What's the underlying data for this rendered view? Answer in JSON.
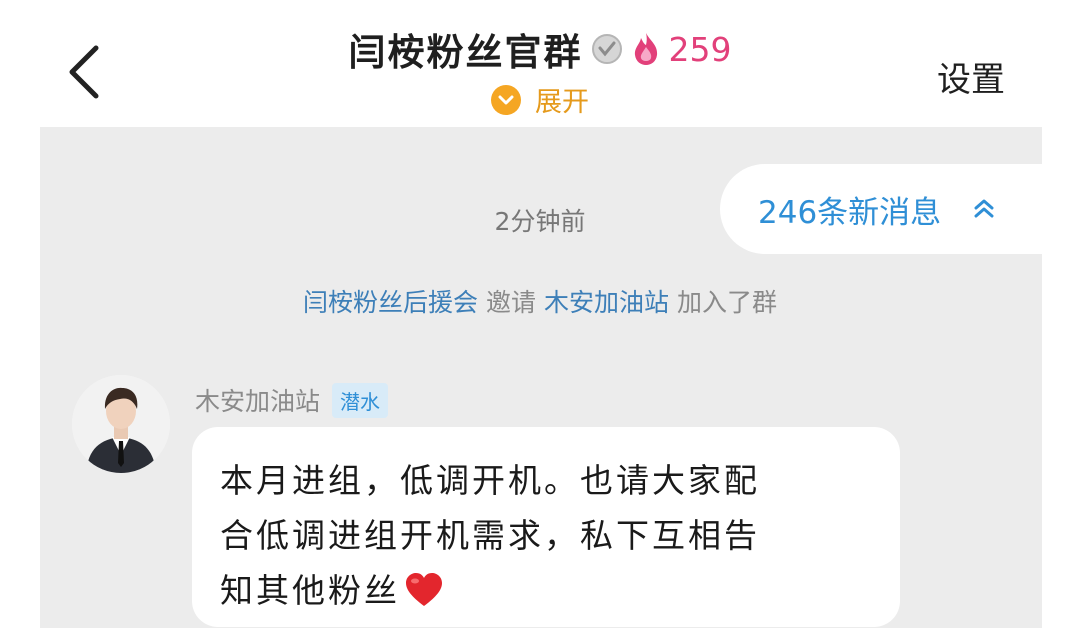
{
  "header": {
    "title": "闫桉粉丝官群",
    "heat_count": "259",
    "expand_label": "展开",
    "settings_label": "设置"
  },
  "chat": {
    "timestamp": "2分钟前",
    "new_messages_label": "246条新消息",
    "system_notice": {
      "inviter": "闫桉粉丝后援会",
      "verb": "邀请",
      "invitee": "木安加油站",
      "suffix": "加入了群"
    },
    "message": {
      "sender_name": "木安加油站",
      "role_tag": "潜水",
      "line1": "本月进组，低调开机。也请大家配",
      "line2": "合低调进组开机需求，私下互相告",
      "line3": "知其他粉丝"
    }
  },
  "colors": {
    "accent_blue": "#2f8fd6",
    "heat_pink": "#e2407a",
    "expand_orange": "#f5a623",
    "chat_bg": "#ececec"
  },
  "icons": {
    "back": "chevron-left-icon",
    "badge": "verified-badge-icon",
    "fire": "fire-icon",
    "expand": "chevron-down-icon",
    "new_messages": "double-chevron-up-icon",
    "heart": "heart-icon"
  }
}
